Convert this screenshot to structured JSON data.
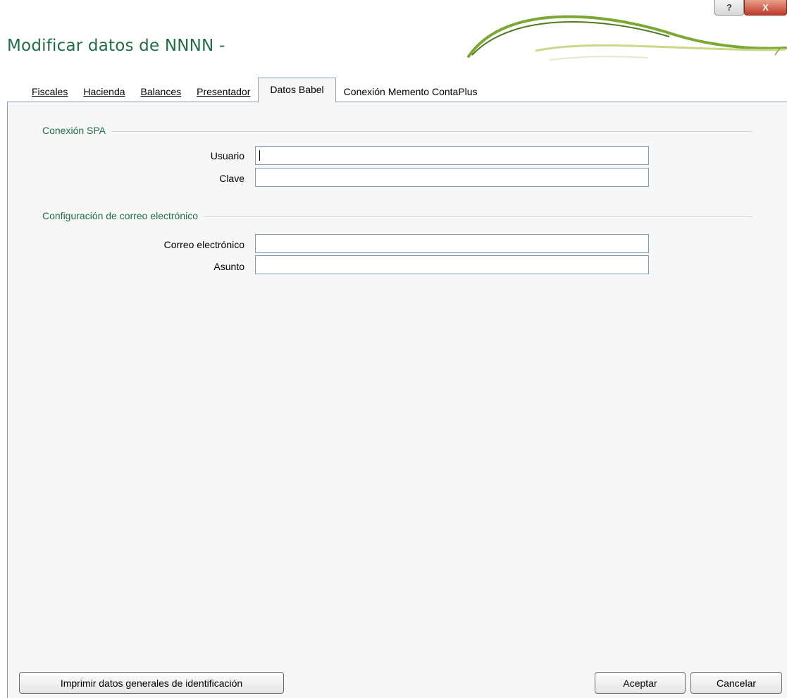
{
  "window": {
    "title": "Modificar datos de NNNN -",
    "help_glyph": "?",
    "close_glyph": "X"
  },
  "tabs": [
    {
      "label": "Fiscales",
      "active": false
    },
    {
      "label": "Hacienda",
      "active": false
    },
    {
      "label": "Balances",
      "active": false
    },
    {
      "label": "Presentador",
      "active": false
    },
    {
      "label": "Datos Babel",
      "active": true
    },
    {
      "label": "Conexión Memento ContaPlus",
      "active": false
    }
  ],
  "sections": {
    "spa": {
      "title": "Conexión SPA",
      "usuario_label": "Usuario",
      "usuario_value": "",
      "clave_label": "Clave",
      "clave_value": ""
    },
    "email": {
      "title": "Configuración de correo electrónico",
      "correo_label": "Correo electrónico",
      "correo_value": "",
      "asunto_label": "Asunto",
      "asunto_value": ""
    }
  },
  "buttons": {
    "print_label": "Imprimir datos generales de identificación",
    "accept_label": "Aceptar",
    "cancel_label": "Cancelar"
  },
  "colors": {
    "accent_green": "#1f6e47",
    "panel_bg": "#f7f7f7",
    "field_border": "#7f9db9"
  }
}
